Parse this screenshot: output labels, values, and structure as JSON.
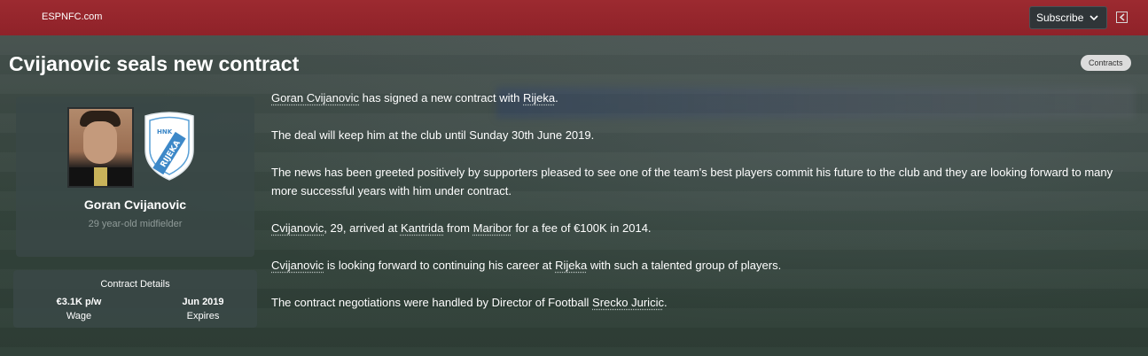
{
  "header": {
    "brand": "ESPNFC.com",
    "subscribe_label": "Subscribe",
    "colors": {
      "bar": "#9c2a30",
      "button": "#2f3538"
    }
  },
  "article": {
    "title": "Cvijanovic seals new contract",
    "tag": "Contracts",
    "paragraphs": [
      [
        {
          "text": "Goran Cvijanovic",
          "link": true
        },
        {
          "text": " has signed a new contract with ",
          "link": false
        },
        {
          "text": "Rijeka",
          "link": true
        },
        {
          "text": ".",
          "link": false
        }
      ],
      [
        {
          "text": "The deal will keep him at the club until Sunday 30th June 2019.",
          "link": false
        }
      ],
      [
        {
          "text": "The news has been greeted positively by supporters pleased to see one of the team's best players commit his future to the club and they are looking forward to many more successful years with him under contract.",
          "link": false
        }
      ],
      [
        {
          "text": "Cvijanovic",
          "link": true
        },
        {
          "text": ", 29, arrived at ",
          "link": false
        },
        {
          "text": "Kantrida",
          "link": true
        },
        {
          "text": " from ",
          "link": false
        },
        {
          "text": "Maribor",
          "link": true
        },
        {
          "text": " for a fee of €100K in 2014.",
          "link": false
        }
      ],
      [
        {
          "text": "Cvijanovic",
          "link": true
        },
        {
          "text": " is looking forward to continuing his career at ",
          "link": false
        },
        {
          "text": "Rijeka",
          "link": true
        },
        {
          "text": " with such a talented group of players.",
          "link": false
        }
      ],
      [
        {
          "text": "The contract negotiations were handled by Director of Football ",
          "link": false
        },
        {
          "text": "Srecko Juricic",
          "link": true
        },
        {
          "text": ".",
          "link": false
        }
      ]
    ]
  },
  "player": {
    "name": "Goran Cvijanovic",
    "description": "29 year-old midfielder",
    "club_crest_icon": "hnk-rijeka-crest",
    "crest_text_top": "HNK",
    "crest_text_main": "RIJEKA"
  },
  "contract": {
    "title": "Contract Details",
    "wage_value": "€3.1K p/w",
    "wage_label": "Wage",
    "expires_value": "Jun 2019",
    "expires_label": "Expires"
  }
}
